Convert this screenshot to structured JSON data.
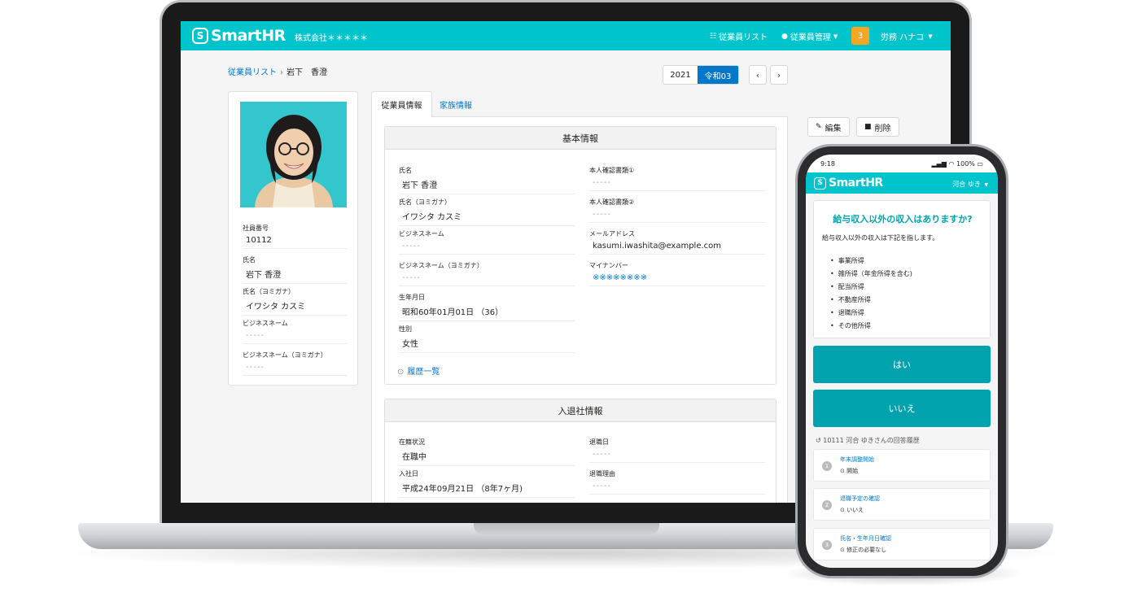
{
  "laptop": {
    "header": {
      "brand": "SmartHR",
      "logo_letter": "S",
      "company": "株式会社＊＊＊＊＊",
      "nav_list": "従業員リスト",
      "nav_manage": "従業員管理",
      "notification_count": "3",
      "user": "労務 ハナコ"
    },
    "breadcrumb": {
      "root": "従業員リスト",
      "sep": "›",
      "current": "岩下　香澄"
    },
    "year": {
      "year": "2021",
      "era": "令和03",
      "prev": "‹",
      "next": "›"
    },
    "profile": {
      "fields": [
        {
          "label": "社員番号",
          "value": "10112"
        },
        {
          "label": "氏名",
          "value": "岩下 香澄"
        },
        {
          "label": "氏名（ヨミガナ）",
          "value": "イワシタ カスミ"
        },
        {
          "label": "ビジネスネーム",
          "value": "-----"
        },
        {
          "label": "ビジネスネーム（ヨミガナ）",
          "value": "-----"
        }
      ]
    },
    "tabs": {
      "active": "従業員情報",
      "other": "家族情報"
    },
    "actions": {
      "edit": "編集",
      "delete": "削除"
    },
    "basic": {
      "title": "基本情報",
      "left": [
        {
          "label": "氏名",
          "value": "岩下 香澄"
        },
        {
          "label": "氏名（ヨミガナ）",
          "value": "イワシタ カスミ"
        },
        {
          "label": "ビジネスネーム",
          "value": "-----"
        },
        {
          "label": "ビジネスネーム（ヨミガナ）",
          "value": "-----"
        },
        {
          "label": "生年月日",
          "value": "昭和60年01月01日 （36）"
        },
        {
          "label": "性別",
          "value": "女性"
        }
      ],
      "right": [
        {
          "label": "本人確認書類①",
          "value": "-----"
        },
        {
          "label": "本人確認書類②",
          "value": "-----"
        },
        {
          "label": "メールアドレス",
          "value": "kasumi.iwashita@example.com"
        },
        {
          "label": "マイナンバー",
          "value": "※※※※※※※※"
        }
      ],
      "history": "履歴一覧"
    },
    "join": {
      "title": "入退社情報",
      "left": [
        {
          "label": "在籍状況",
          "value": "在職中"
        },
        {
          "label": "入社日",
          "value": "平成24年09月21日 （8年7ヶ月)"
        }
      ],
      "right": [
        {
          "label": "退職日",
          "value": "-----"
        },
        {
          "label": "退職理由",
          "value": "-----"
        }
      ]
    }
  },
  "phone": {
    "status": {
      "time": "9:18",
      "battery": "100%"
    },
    "header": {
      "brand": "SmartHR",
      "logo_letter": "S",
      "user": "河合 ゆき"
    },
    "question": {
      "title": "給与収入以外の収入はありますか?",
      "desc": "給与収入以外の収入は下記を指します。",
      "items": [
        "事業所得",
        "雑所得（年金所得を含む)",
        "配当所得",
        "不動産所得",
        "退職所得",
        "その他所得"
      ]
    },
    "yes": "はい",
    "no": "いいえ",
    "history_title": "10111 河合 ゆきさんの回答履歴",
    "history": [
      {
        "num": "1",
        "title": "年末調整開始",
        "sub": "開始"
      },
      {
        "num": "2",
        "title": "退職予定の確認",
        "sub": "いいえ"
      },
      {
        "num": "3",
        "title": "氏名・生年月日確認",
        "sub": "修正の必要なし"
      }
    ]
  },
  "colors": {
    "brand": "#00c4cc",
    "brand_dark": "#00a3ad",
    "link": "#0077c7",
    "badge": "#f5a623"
  }
}
